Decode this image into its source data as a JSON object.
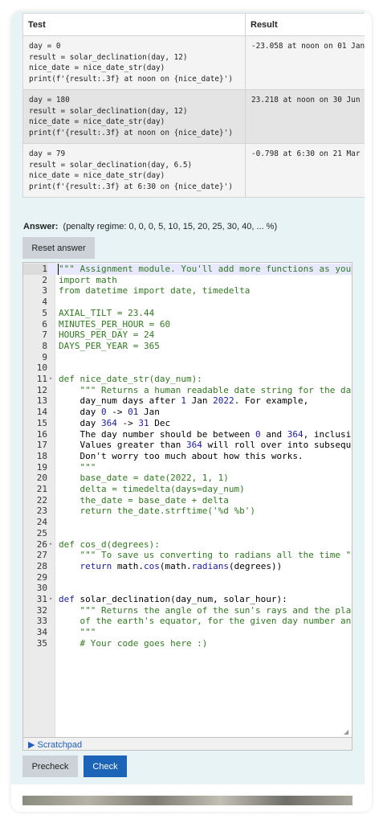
{
  "tests_table": {
    "headers": [
      "Test",
      "Result"
    ],
    "rows": [
      {
        "test": "day = 0\nresult = solar_declination(day, 12)\nnice_date = nice_date_str(day)\nprint(f'{result:.3f} at noon on {nice_date}')",
        "result": "-23.058 at noon on 01 Jan"
      },
      {
        "test": "day = 180\nresult = solar_declination(day, 12)\nnice_date = nice_date_str(day)\nprint(f'{result:.3f} at noon on {nice_date}')",
        "result": "23.218 at noon on 30 Jun"
      },
      {
        "test": "day = 79\nresult = solar_declination(day, 6.5)\nnice_date = nice_date_str(day)\nprint(f'{result:.3f} at 6:30 on {nice_date}')",
        "result": "-0.798 at 6:30 on 21 Mar"
      }
    ]
  },
  "answer": {
    "label": "Answer:",
    "penalty": "(penalty regime: 0, 0, 0, 5, 10, 15, 20, 25, 30, 40, ... %)"
  },
  "reset_label": "Reset answer",
  "editor": {
    "lines": [
      "\"\"\" Assignment module. You'll add more functions as you",
      "import math",
      "from datetime import date, timedelta",
      "",
      "AXIAL_TILT = 23.44",
      "MINUTES_PER_HOUR = 60",
      "HOURS_PER_DAY = 24",
      "DAYS_PER_YEAR = 365",
      "",
      "",
      "def nice_date_str(day_num):",
      "    \"\"\" Returns a human readable date string for the da",
      "    day_num days after 1 Jan 2022. For example,",
      "    day 0 -> 01 Jan",
      "    day 364 -> 31 Dec",
      "    The day number should be between 0 and 364, inclusi",
      "    Values greater than 364 will roll over into subsequ",
      "    Don't worry too much about how this works.",
      "    \"\"\"",
      "    base_date = date(2022, 1, 1)",
      "    delta = timedelta(days=day_num)",
      "    the_date = base_date + delta",
      "    return the_date.strftime('%d %b')",
      "",
      "",
      "def cos_d(degrees):",
      "    \"\"\" To save us converting to radians all the time \"",
      "    return math.cos(math.radians(degrees))",
      "",
      "",
      "def solar_declination(day_num, solar_hour):",
      "    \"\"\" Returns the angle of the sun's rays and the pla",
      "    of the earth's equator, for the given day number an",
      "    \"\"\"",
      "    # Your code goes here :)"
    ],
    "fold_lines": [
      11,
      26,
      31
    ],
    "fold_glyph": "▾",
    "resize_glyph": "◢"
  },
  "scratchpad_label": "▶ Scratchpad",
  "precheck_label": "Precheck",
  "check_label": "Check",
  "colors": {
    "check_button": "#1b64b8",
    "panel_bg": "#e7f3f5",
    "secondary_button": "#cdd2d8"
  }
}
